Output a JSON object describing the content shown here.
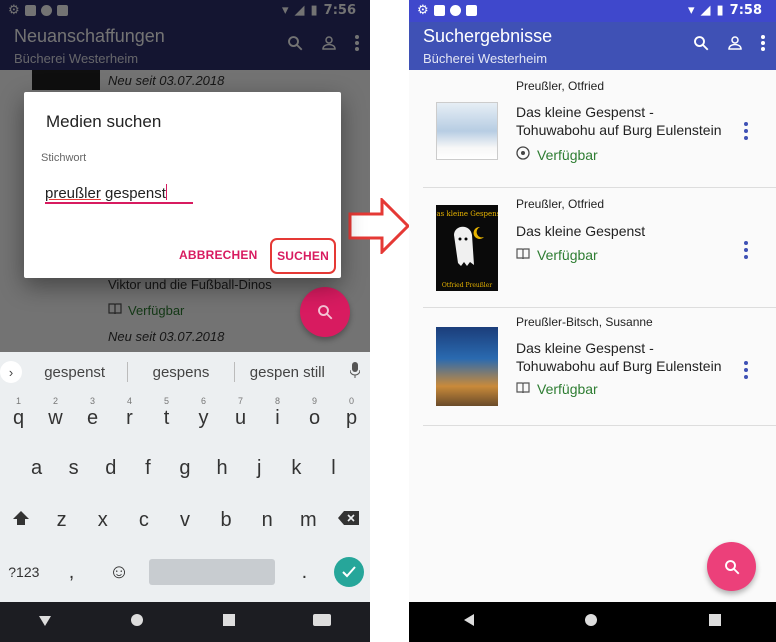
{
  "left": {
    "status": {
      "time": "7:56"
    },
    "appbar": {
      "title": "Neuanschaffungen",
      "subtitle": "Bücherei Westerheim"
    },
    "background_items": [
      {
        "date": "Neu seit 03.07.2018"
      },
      {
        "title": "Viktor und die Fußball-Dinos",
        "availability": "Verfügbar",
        "date": "Neu seit 03.07.2018"
      }
    ],
    "dialog": {
      "title": "Medien suchen",
      "field_label": "Stichwort",
      "query_word1": "preußler",
      "query_word2": "gespenst",
      "cancel_label": "ABBRECHEN",
      "search_label": "SUCHEN"
    },
    "keyboard": {
      "suggestions": [
        "gespenst",
        "gespens",
        "gespen still"
      ],
      "row1": [
        {
          "k": "q",
          "n": "1"
        },
        {
          "k": "w",
          "n": "2"
        },
        {
          "k": "e",
          "n": "3"
        },
        {
          "k": "r",
          "n": "4"
        },
        {
          "k": "t",
          "n": "5"
        },
        {
          "k": "y",
          "n": "6"
        },
        {
          "k": "u",
          "n": "7"
        },
        {
          "k": "i",
          "n": "8"
        },
        {
          "k": "o",
          "n": "9"
        },
        {
          "k": "p",
          "n": "0"
        }
      ],
      "row2": [
        "a",
        "s",
        "d",
        "f",
        "g",
        "h",
        "j",
        "k",
        "l"
      ],
      "row3": [
        "z",
        "x",
        "c",
        "v",
        "b",
        "n",
        "m"
      ],
      "symbols_label": "?123",
      "comma": ",",
      "period": "."
    }
  },
  "right": {
    "status": {
      "time": "7:58"
    },
    "appbar": {
      "title": "Suchergebnisse",
      "subtitle": "Bücherei Westerheim"
    },
    "results": [
      {
        "author": "Preußler, Otfried",
        "title_line1": "Das kleine Gespenst -",
        "title_line2": "Tohuwabohu auf Burg Eulenstein",
        "availability": "Verfügbar"
      },
      {
        "author": "Preußler, Otfried",
        "title_line1": "Das kleine Gespenst",
        "title_line2": "",
        "availability": "Verfügbar"
      },
      {
        "author": "Preußler-Bitsch, Susanne",
        "title_line1": "Das kleine Gespenst -",
        "title_line2": "Tohuwabohu auf Burg Eulenstein",
        "availability": "Verfügbar"
      }
    ]
  },
  "colors": {
    "primary": "#3f51b5",
    "accent": "#d81b60",
    "available": "#2e7d32",
    "highlight": "#e53935"
  },
  "icons": [
    "gear-icon",
    "mail-icon",
    "wifi-icon",
    "signal-icon",
    "battery-icon",
    "search-icon",
    "account-icon",
    "more-vert-icon",
    "book-icon",
    "disc-icon",
    "back-icon",
    "home-icon",
    "recents-icon",
    "arrow-right-icon"
  ]
}
